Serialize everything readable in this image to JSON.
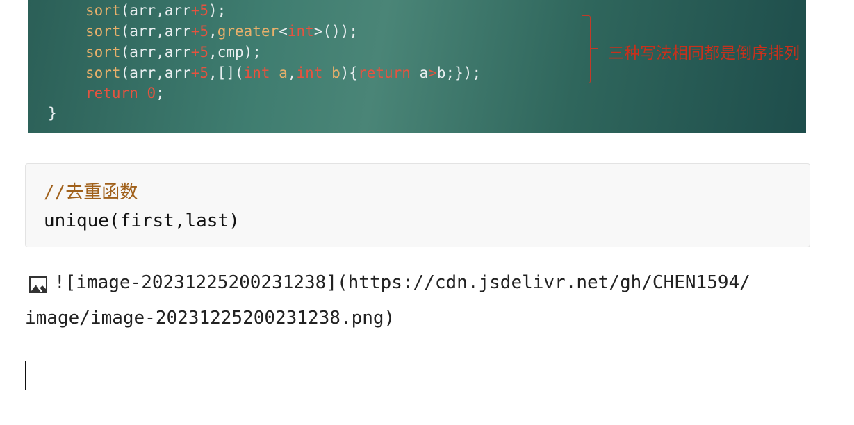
{
  "code_image": {
    "lines": [
      {
        "parts": [
          {
            "t": "sort",
            "c": "fn"
          },
          {
            "t": "(arr,arr",
            "c": ""
          },
          {
            "t": "+5",
            "c": "red"
          },
          {
            "t": ");",
            "c": ""
          }
        ]
      },
      {
        "parts": [
          {
            "t": "sort",
            "c": "fn"
          },
          {
            "t": "(arr,arr",
            "c": ""
          },
          {
            "t": "+5",
            "c": "red"
          },
          {
            "t": ",",
            "c": ""
          },
          {
            "t": "greater",
            "c": "fn"
          },
          {
            "t": "<",
            "c": ""
          },
          {
            "t": "int",
            "c": "red"
          },
          {
            "t": ">());",
            "c": ""
          }
        ]
      },
      {
        "parts": [
          {
            "t": "sort",
            "c": "fn"
          },
          {
            "t": "(arr,arr",
            "c": ""
          },
          {
            "t": "+5",
            "c": "red"
          },
          {
            "t": ",cmp);",
            "c": ""
          }
        ]
      },
      {
        "parts": [
          {
            "t": "sort",
            "c": "fn"
          },
          {
            "t": "(arr,arr",
            "c": ""
          },
          {
            "t": "+5",
            "c": "red"
          },
          {
            "t": ",[](",
            "c": ""
          },
          {
            "t": "int",
            "c": "red"
          },
          {
            "t": " ",
            "c": ""
          },
          {
            "t": "a",
            "c": "fn"
          },
          {
            "t": ",",
            "c": ""
          },
          {
            "t": "int",
            "c": "red"
          },
          {
            "t": " ",
            "c": ""
          },
          {
            "t": "b",
            "c": "fn"
          },
          {
            "t": "){",
            "c": ""
          },
          {
            "t": "return",
            "c": "red"
          },
          {
            "t": " a",
            "c": ""
          },
          {
            "t": ">",
            "c": "red"
          },
          {
            "t": "b;});",
            "c": ""
          }
        ]
      },
      {
        "parts": [
          {
            "t": "return",
            "c": "red"
          },
          {
            "t": " ",
            "c": ""
          },
          {
            "t": "0",
            "c": "red"
          },
          {
            "t": ";",
            "c": ""
          }
        ]
      }
    ],
    "closing_brace": "}",
    "annotation": "三种写法相同都是倒序排列"
  },
  "code_block": {
    "comment": "//去重函数",
    "code": "unique(first,last)"
  },
  "markdown": {
    "line1": "![image-20231225200231238](https://cdn.jsdelivr.net/gh/CHEN1594/",
    "line2": "image/image-20231225200231238.png)",
    "broken_image_icon": "broken-image-icon"
  }
}
